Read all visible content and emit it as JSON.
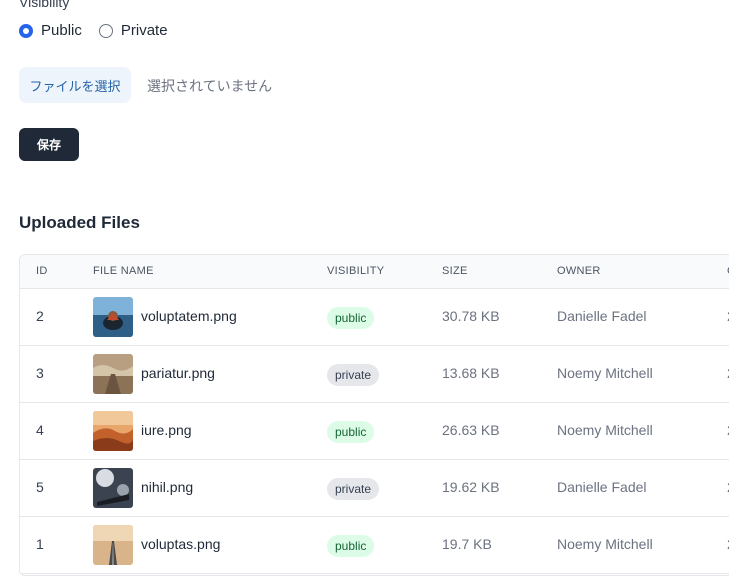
{
  "form": {
    "visibility_label": "Visibility",
    "visibility_options": [
      {
        "label": "Public",
        "checked": true
      },
      {
        "label": "Private",
        "checked": false
      }
    ],
    "file_button_label": "ファイルを選択",
    "file_status": "選択されていません",
    "save_label": "保存"
  },
  "files_section": {
    "title": "Uploaded Files",
    "columns": [
      "ID",
      "FILE NAME",
      "VISIBILITY",
      "SIZE",
      "OWNER",
      "C"
    ],
    "rows": [
      {
        "id": "2",
        "file_name": "voluptatem.png",
        "visibility": "public",
        "size": "30.78 KB",
        "owner": "Danielle Fadel",
        "extra": "2"
      },
      {
        "id": "3",
        "file_name": "pariatur.png",
        "visibility": "private",
        "size": "13.68 KB",
        "owner": "Noemy Mitchell",
        "extra": "2"
      },
      {
        "id": "4",
        "file_name": "iure.png",
        "visibility": "public",
        "size": "26.63 KB",
        "owner": "Noemy Mitchell",
        "extra": "2"
      },
      {
        "id": "5",
        "file_name": "nihil.png",
        "visibility": "private",
        "size": "19.62 KB",
        "owner": "Danielle Fadel",
        "extra": "2"
      },
      {
        "id": "1",
        "file_name": "voluptas.png",
        "visibility": "public",
        "size": "19.7 KB",
        "owner": "Noemy Mitchell",
        "extra": "2"
      }
    ]
  },
  "colors": {
    "accent": "#2563eb",
    "primary_button": "#1f2937",
    "public_badge_bg": "#dcfce7",
    "private_badge_bg": "#e5e7eb"
  }
}
